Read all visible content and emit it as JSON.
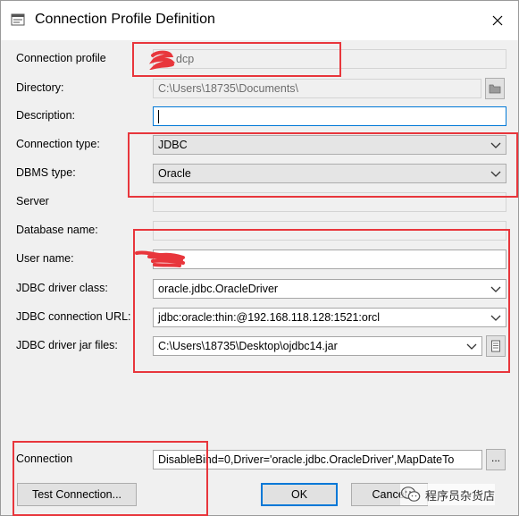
{
  "window": {
    "title": "Connection Profile Definition"
  },
  "form": {
    "connection_profile": {
      "label": "Connection profile",
      "value": "dcp"
    },
    "directory": {
      "label": "Directory:",
      "value": "C:\\Users\\18735\\Documents\\"
    },
    "description": {
      "label": "Description:",
      "value": ""
    },
    "connection_type": {
      "label": "Connection type:",
      "value": "JDBC"
    },
    "dbms_type": {
      "label": "DBMS type:",
      "value": "Oracle"
    },
    "server": {
      "label": "Server",
      "value": ""
    },
    "database_name": {
      "label": "Database name:",
      "value": ""
    },
    "user_name": {
      "label": "User name:",
      "value": ""
    },
    "jdbc_driver_class": {
      "label": "JDBC driver class:",
      "value": "oracle.jdbc.OracleDriver"
    },
    "jdbc_connection_url": {
      "label": "JDBC connection URL:",
      "value": "jdbc:oracle:thin:@192.168.118.128:1521:orcl"
    },
    "jdbc_driver_jar_files": {
      "label": "JDBC driver jar files:",
      "value": "C:\\Users\\18735\\Desktop\\ojdbc14.jar"
    },
    "connection": {
      "label": "Connection",
      "value": "DisableBind=0,Driver='oracle.jdbc.OracleDriver',MapDateTo",
      "ellipsis": "..."
    }
  },
  "buttons": {
    "test_connection": "Test Connection...",
    "ok": "OK",
    "cancel": "Cancel"
  },
  "watermark": {
    "text": "程序员杂货店"
  },
  "colors": {
    "annotation": "#e8363c",
    "focus": "#0078d7"
  }
}
